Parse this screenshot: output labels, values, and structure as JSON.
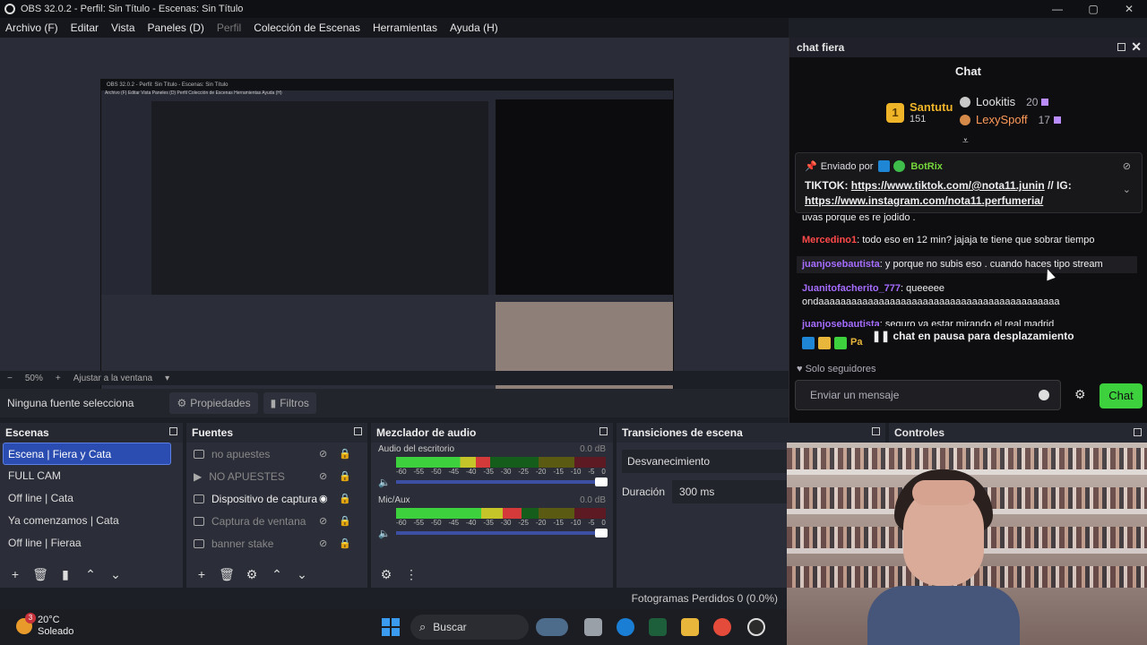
{
  "window": {
    "title": "OBS 32.0.2 - Perfil: Sin Título - Escenas: Sin Título",
    "controls": [
      "—",
      "▢",
      "✕"
    ]
  },
  "menu": [
    "Archivo (F)",
    "Editar",
    "Vista",
    "Paneles (D)",
    "Perfil",
    "Colección de Escenas",
    "Herramientas",
    "Ayuda (H)"
  ],
  "nested": {
    "title": "OBS 32.0.2 - Perfil: Sin Título - Escenas: Sin Título",
    "menu": "Archivo (F)   Editar   Vista   Paneles (D)   Perfil   Colección de Escenas   Herramientas   Ayuda (H)"
  },
  "zoom": {
    "level": "50%",
    "minus": "−",
    "plus": "+",
    "fit": "Ajustar a la ventana",
    "caret": "▾"
  },
  "source_bar": {
    "label": "Ninguna fuente selecciona",
    "properties": "Propiedades",
    "filters": "Filtros"
  },
  "docks": {
    "scenes": {
      "title": "Escenas",
      "items": [
        "Escena | Fiera y Cata",
        "FULL CAM",
        "Off line | Cata",
        "Ya comenzamos | Cata",
        "Off line | Fieraa"
      ],
      "selected": 0
    },
    "sources": {
      "title": "Fuentes",
      "items": [
        {
          "label": "no apuestes",
          "visible": false
        },
        {
          "label": "NO APUESTES",
          "visible": false
        },
        {
          "label": "Dispositivo de captura",
          "visible": true
        },
        {
          "label": "Captura de ventana",
          "visible": false
        },
        {
          "label": "banner stake",
          "visible": false
        }
      ]
    },
    "mixer": {
      "title": "Mezclador de audio",
      "channels": [
        {
          "name": "Audio del escritorio",
          "db": "0.0 dB",
          "level": 0.45
        },
        {
          "name": "Mic/Aux",
          "db": "0.0 dB",
          "level": 0.6
        }
      ],
      "ticks": [
        "-60",
        "-55",
        "-50",
        "-45",
        "-40",
        "-35",
        "-30",
        "-25",
        "-20",
        "-15",
        "-10",
        "-5",
        "0"
      ]
    },
    "transitions": {
      "title": "Transiciones de escena",
      "selected": "Desvanecimiento",
      "duration_label": "Duración",
      "duration_value": "300 ms"
    },
    "controls": {
      "title": "Controles"
    }
  },
  "status": {
    "frames": "Fotogramas Perdidos 0 (0.0%)"
  },
  "taskbar": {
    "temp": "20°C",
    "weather": "Soleado",
    "badge": "3",
    "search": "Buscar"
  },
  "chat": {
    "dock_title": "chat fiera",
    "title": "Chat",
    "leaderboard": [
      {
        "rank": "1",
        "name": "Santutu",
        "points": "151"
      },
      {
        "rank": "2",
        "name": "Lookitis",
        "points": "20"
      },
      {
        "rank": "3",
        "name": "LexySpoff",
        "points": "17"
      }
    ],
    "pinned": {
      "sent_by": "Enviado por",
      "bot": "BotRix",
      "message_prefix": "TIKTOK: ",
      "link1": "https://www.tiktok.com/@nota11.junin",
      "mid": " // IG: ",
      "link2": "https://www.instagram.com/nota11.perfumeria/"
    },
    "messages": [
      {
        "user": "",
        "text": "uvas porque es re jodido ."
      },
      {
        "user": "Mercedino1",
        "text": ": todo eso en 12 min? jajaja te tiene que sobrar tiempo"
      },
      {
        "user": "juanjosebautista",
        "text": ": y porque no subis eso . cuando haces tipo stream"
      },
      {
        "user": "Juanitofacherito_777",
        "text": ": queeeee ondaaaaaaaaaaaaaaaaaaaaaaaaaaaaaaaaaaaaaaaaaaaa"
      },
      {
        "user": "juanjosebautista",
        "text": ": seguro va estar mirando el real madrid"
      }
    ],
    "paused": "chat en pausa para desplazamiento",
    "emote_user_partial": "Pa",
    "followers_only": "Solo seguidores",
    "placeholder": "Enviar un mensaje",
    "send": "Chat"
  },
  "colors": {
    "accent": "#2b4cb0",
    "chat_green": "#3dd13d",
    "twitch_purple": "#a56cff"
  }
}
